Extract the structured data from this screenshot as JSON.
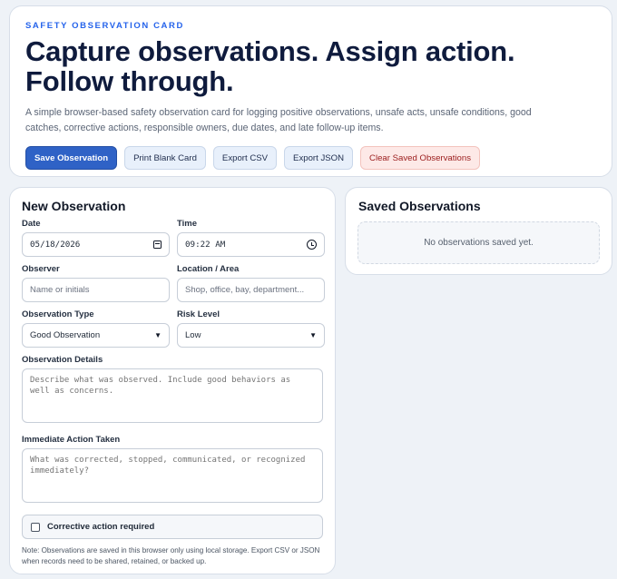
{
  "header": {
    "eyebrow": "SAFETY OBSERVATION CARD",
    "title": "Capture observations. Assign action. Follow through.",
    "description": "A simple browser-based safety observation card for logging positive observations, unsafe acts, unsafe conditions, good catches, corrective actions, responsible owners, due dates, and late follow-up items."
  },
  "toolbar": {
    "save_label": "Save Observation",
    "print_label": "Print Blank Card",
    "export_csv_label": "Export CSV",
    "export_json_label": "Export JSON",
    "clear_label": "Clear Saved Observations"
  },
  "form": {
    "title": "New Observation",
    "date": {
      "label": "Date",
      "value": "05/18/2026",
      "icon": "calendar-icon"
    },
    "time": {
      "label": "Time",
      "value": "09:22 AM",
      "icon": "clock-icon"
    },
    "observer": {
      "label": "Observer",
      "placeholder": "Name or initials"
    },
    "location": {
      "label": "Location / Area",
      "placeholder": "Shop, office, bay, department..."
    },
    "observation_type": {
      "label": "Observation Type",
      "value": "Good Observation"
    },
    "risk_level": {
      "label": "Risk Level",
      "value": "Low"
    },
    "details": {
      "label": "Observation Details",
      "placeholder": "Describe what was observed. Include good behaviors as well as concerns."
    },
    "immediate_action": {
      "label": "Immediate Action Taken",
      "placeholder": "What was corrected, stopped, communicated, or recognized immediately?"
    },
    "corrective_required": {
      "label": "Corrective action required",
      "checked": false
    },
    "note": "Note: Observations are saved in this browser only using local storage. Export CSV or JSON when records need to be shared, retained, or backed up."
  },
  "saved": {
    "title": "Saved Observations",
    "empty_text": "No observations saved yet."
  },
  "colors": {
    "primary": "#2f62c6",
    "danger_bg": "#fde9e7",
    "danger_text": "#9b1c1c",
    "eyebrow": "#2563eb"
  }
}
